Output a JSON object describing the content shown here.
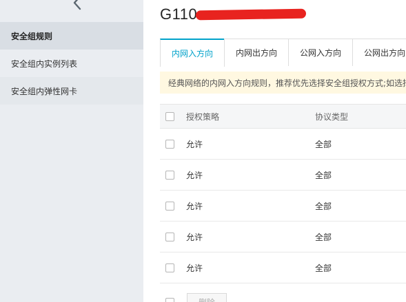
{
  "sidebar": {
    "items": [
      {
        "label": "安全组规则"
      },
      {
        "label": "安全组内实例列表"
      },
      {
        "label": "安全组内弹性网卡"
      }
    ]
  },
  "header": {
    "title_visible": "G110",
    "title_redacted": true
  },
  "tabs": [
    {
      "label": "内网入方向",
      "active": true
    },
    {
      "label": "内网出方向"
    },
    {
      "label": "公网入方向"
    },
    {
      "label": "公网出方向"
    }
  ],
  "notice": {
    "text": "经典网络的内网入方向规则，推荐优先选择安全组授权方式;如选择"
  },
  "table": {
    "columns": [
      "授权策略",
      "协议类型"
    ],
    "rows": [
      {
        "policy": "允许",
        "protocol": "全部"
      },
      {
        "policy": "允许",
        "protocol": "全部"
      },
      {
        "policy": "允许",
        "protocol": "全部"
      },
      {
        "policy": "允许",
        "protocol": "全部"
      },
      {
        "policy": "允许",
        "protocol": "全部"
      }
    ]
  },
  "footer": {
    "delete_label": "删除"
  },
  "colors": {
    "accent": "#00a2ca",
    "sidebar_bg": "#eaedf1",
    "notice_bg": "#fff8e1",
    "redaction": "#e8231f"
  },
  "icons": {
    "back": "chevron-left-icon"
  }
}
